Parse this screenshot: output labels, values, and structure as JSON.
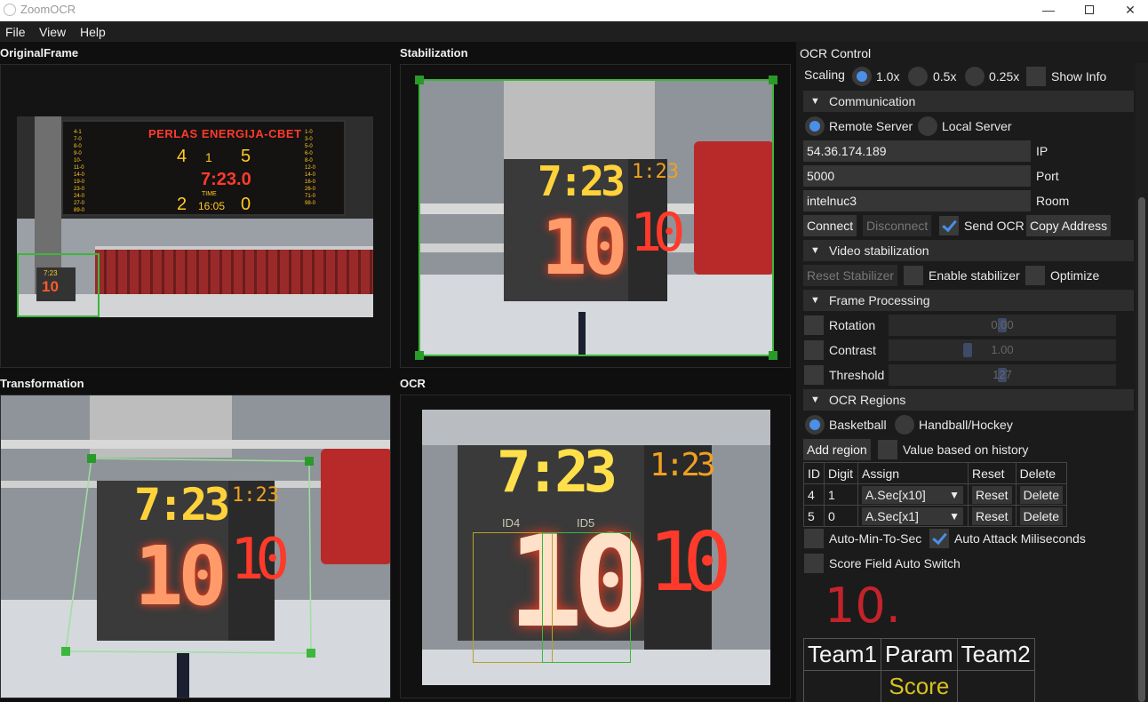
{
  "window": {
    "title": "ZoomOCR"
  },
  "menu": {
    "items": [
      "File",
      "View",
      "Help"
    ]
  },
  "panels": {
    "original": "OriginalFrame",
    "stabilization": "Stabilization",
    "transformation": "Transformation",
    "ocr": "OCR"
  },
  "scoreboard": {
    "banner": "PERLAS ENERGIJA-CBET",
    "home_score": "4",
    "period": "1",
    "away_score": "5",
    "clock": "7:23.0",
    "left_num": "2",
    "time_label": "TIME",
    "sub_clock": "16:05",
    "right_num": "0",
    "left_roster": [
      "4-1",
      "7-0",
      "8-0",
      "9-0",
      "10-",
      "11-0",
      "14-0",
      "19-0",
      "23-0",
      "24-0",
      "27-0",
      "89-0"
    ],
    "right_roster": [
      "1-0",
      "3-0",
      "5-0",
      "6-0",
      "8-0",
      "12-0",
      "14-0",
      "16-0",
      "26-0",
      "71-0",
      "98-0"
    ]
  },
  "shotclock": {
    "clock": "7:23",
    "value": "10",
    "side": "10",
    "side_top": "1:23"
  },
  "ocr_overlay": {
    "id4": "ID4",
    "id5": "ID5"
  },
  "control": {
    "title": "OCR Control",
    "scaling_label": "Scaling",
    "scaling_options": [
      "1.0x",
      "0.5x",
      "0.25x"
    ],
    "scaling_selected": "1.0x",
    "show_info": "Show Info",
    "communication": {
      "title": "Communication",
      "remote": "Remote Server",
      "local": "Local Server",
      "selected": "Remote Server",
      "ip_value": "54.36.174.189",
      "ip_label": "IP",
      "port_value": "5000",
      "port_label": "Port",
      "room_value": "intelnuc3",
      "room_label": "Room",
      "connect": "Connect",
      "disconnect": "Disconnect",
      "send_ocr": "Send OCR",
      "send_ocr_checked": true,
      "copy_address": "Copy Address"
    },
    "video": {
      "title": "Video stabilization",
      "reset": "Reset Stabilizer",
      "enable": "Enable stabilizer",
      "optimize": "Optimize"
    },
    "frame": {
      "title": "Frame Processing",
      "rotation_label": "Rotation",
      "rotation_value": "0.00",
      "rotation_level": 0.5,
      "contrast_label": "Contrast",
      "contrast_value": "1.00",
      "contrast_level": 0.34,
      "threshold_label": "Threshold",
      "threshold_value": "127",
      "threshold_level": 0.5
    },
    "regions": {
      "title": "OCR Regions",
      "basketball": "Basketball",
      "handball": "Handball/Hockey",
      "selected": "Basketball",
      "add_region": "Add region",
      "history": "Value based on history",
      "columns": [
        "ID",
        "Digit",
        "Assign",
        "Reset",
        "Delete"
      ],
      "rows": [
        {
          "id": "4",
          "digit": "1",
          "assign": "A.Sec[x10]",
          "reset": "Reset",
          "delete": "Delete"
        },
        {
          "id": "5",
          "digit": "0",
          "assign": "A.Sec[x1]",
          "reset": "Reset",
          "delete": "Delete"
        }
      ],
      "auto_min": "Auto-Min-To-Sec",
      "auto_attack": "Auto Attack Miliseconds",
      "auto_attack_checked": true,
      "score_switch": "Score Field Auto Switch"
    },
    "readout": "10.",
    "score_table": {
      "team1": "Team1",
      "param": "Param",
      "team2": "Team2",
      "score": "Score"
    }
  },
  "colors": {
    "accent": "#4a8fe8",
    "readout": "#c4232b",
    "score": "#d8c21d",
    "roi_green": "#3bb83b",
    "roi_yellow": "#b8a02a"
  }
}
